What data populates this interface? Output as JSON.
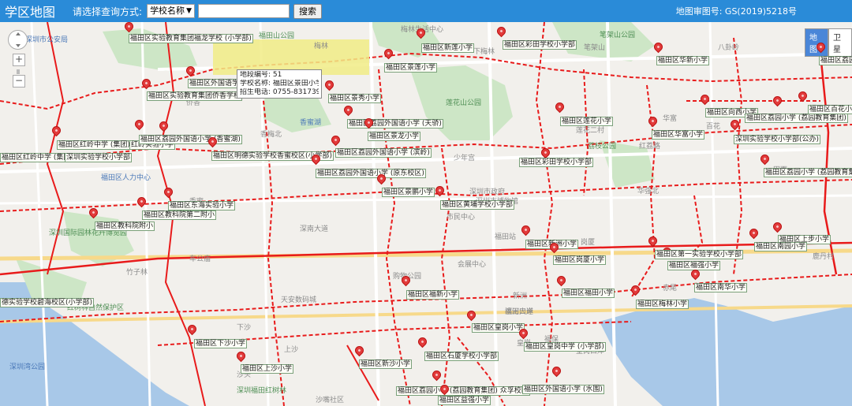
{
  "app": {
    "title": "学区地图",
    "query_label": "请选择查询方式:",
    "query_select": "学校名称",
    "search_button": "搜索",
    "map_number": "地图审图号: GS(2019)5218号"
  },
  "map_type": {
    "map_label": "地图",
    "satellite_label": "卫星"
  },
  "popup": {
    "segment": "地段编号: 51",
    "school": "学校名称: 福田区景田小学",
    "phone": "招生电话: 0755-83173929"
  },
  "schools": [
    "福田区实验教育集团福龙学校 (小学部)",
    "福田区新莲小学",
    "福田区彩田学校小学部",
    "福田区外国语学校",
    "福田区实验教育集团侨香学校",
    "福田区景莲小学",
    "福田区华新小学",
    "福田区荔园",
    "福田区景秀小学",
    "福田区莲花小学",
    "福田区荔园外国语小学 (天骄)",
    "福田区景龙小学",
    "福田区向西小学",
    "福田区红岭中学 (集团)",
    "红岭实验小学",
    "福田区荔园外国语小学 (香蜜湖)",
    "福田区红岭中学 (集团)",
    "深圳实验学校小学部",
    "福田区明德实验学校香蜜校区(小学部)",
    "福田区荔园外国语小学 (滨岭)",
    "福田区荔园外国语小学 (原东校区)",
    "福田区华富小学",
    "深圳实验学校小学部(公办)",
    "福田区荔园小学 (荔园教育集团)",
    "福田区百花小学",
    "福田区荔园小学 (荔园教育集团)",
    "福田区东海实验小学",
    "福田区教科院第二附小",
    "福田区景鹏小学",
    "福田区黄埔学校小学部",
    "福田区教科院附小",
    "福田区上步小学",
    "福田区南园小学",
    "福田区新洲小学",
    "福田区岗厦小学",
    "福田区福强小学",
    "福田区第一实验学校小学部",
    "福田区南华小学",
    "福田区福田小学",
    "福田区福新小学",
    "福田区皇岗小学",
    "福田区下沙小学",
    "福田区石厦学校小学部",
    "福田区新沙小学",
    "福田区皇岗中学 (小学部)",
    "福田区上沙小学",
    "福田区荔园小学 (荔园教育集团) 众孚校区",
    "福田区外国语小学 (水围)",
    "福田区益强小学",
    "福田区彩田学校小学部",
    "福田区梅林小学",
    "德实验学校碧海校区(小学部)"
  ],
  "background_labels": [
    "深圳市公安局",
    "福田山公园",
    "梅林生活中心",
    "笔架山公园",
    "香蜜湖",
    "莲花山公园",
    "深圳市政府",
    "市民中心",
    "少年宫",
    "福田站",
    "会展中心",
    "购物公园",
    "福田口岸",
    "皇岗口岸",
    "深圳湾公园",
    "红树林自然保护区",
    "沙嘴社区",
    "竹子林",
    "车公庙",
    "红荔路",
    "深南大道",
    "滨河大道",
    "华强北",
    "赤尾",
    "皇岗",
    "新洲",
    "上沙",
    "下沙",
    "沙头",
    "福保",
    "鹿丹村",
    "八卦岭",
    "景田",
    "香梅北",
    "福田区人力中心",
    "深圳国际园林花卉博览园",
    "深圳市博物馆",
    "深圳福田红树林",
    "天安数码城",
    "香蜜",
    "侨香",
    "梅林",
    "岗厦",
    "下梅林",
    "笔架山",
    "百花",
    "田面",
    "华富",
    "荔枝公园",
    "莲花二村"
  ]
}
